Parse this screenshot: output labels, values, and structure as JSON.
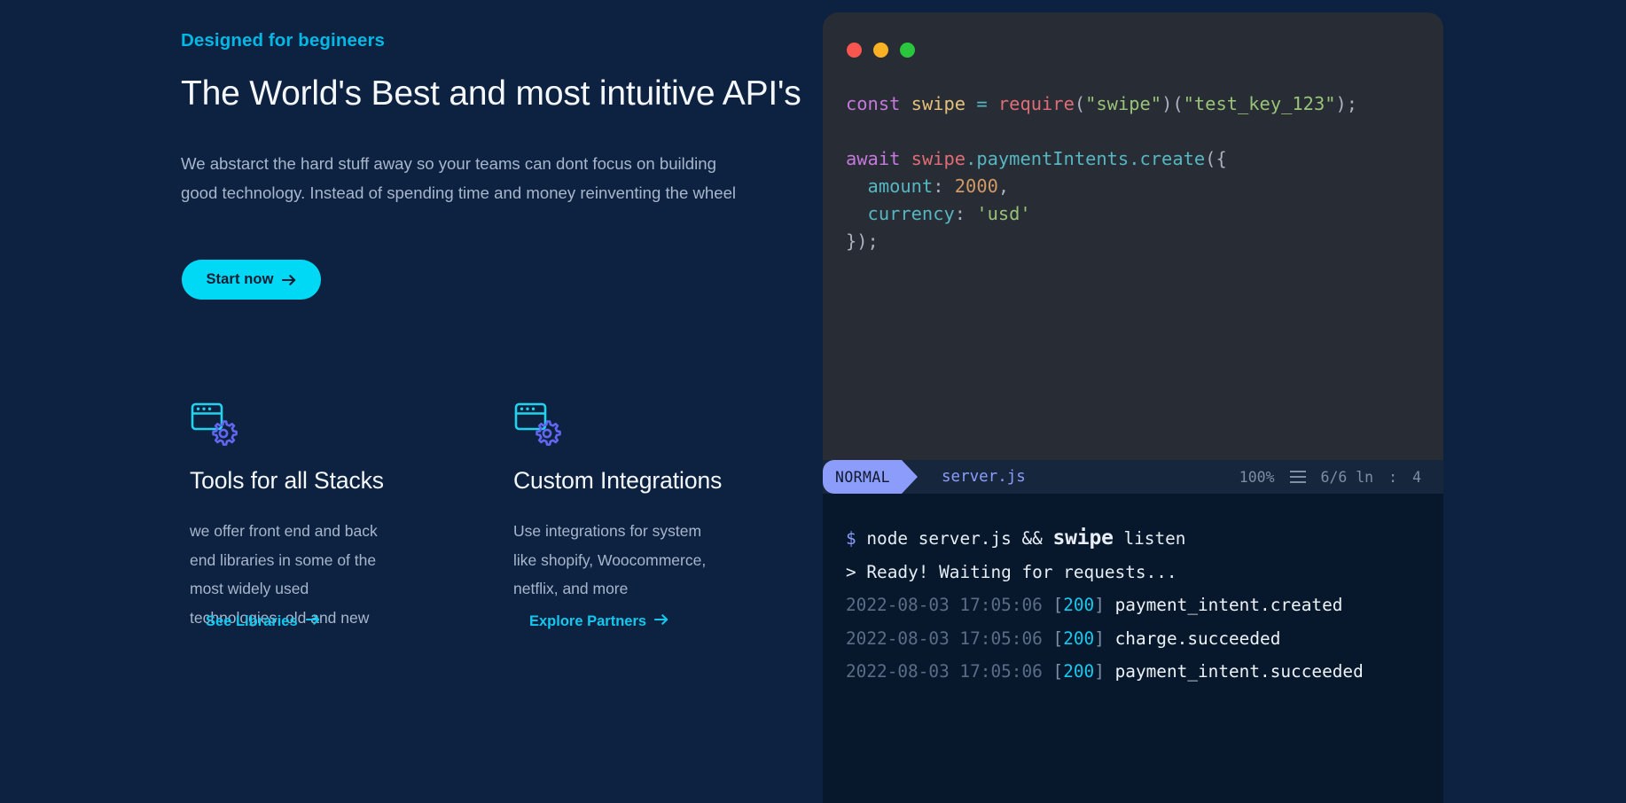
{
  "page": {
    "background_color": "#0d2240"
  },
  "hero": {
    "eyebrow": "Designed for begineers",
    "eyebrow_color": "#00b8e6",
    "title": "The World's Best and most intuitive API's",
    "body": "We abstarct the hard stuff away so your teams can dont focus on building good technology. Instead of spending time and money reinventing the wheel",
    "cta": {
      "label": "Start now",
      "icon": "arrow-right-icon",
      "background_color": "#00d9f5",
      "text_color": "#0a1d33"
    }
  },
  "features": [
    {
      "icon": "browser-window-gear-icon",
      "icon_window_color": "#22d3ee",
      "icon_gear_color": "#6366f1",
      "title": "Tools for all Stacks",
      "body": "we offer front end and back end libraries in some of the most widely used technologies. old and new",
      "link_label": "See Libraries",
      "link_icon": "arrow-right-icon",
      "link_color": "#13c8ef"
    },
    {
      "icon": "browser-window-gear-icon",
      "icon_window_color": "#22d3ee",
      "icon_gear_color": "#6366f1",
      "title": "Custom Integrations",
      "body": "Use integrations for system like shopify, Woocommerce, netflix, and more",
      "link_label": "Explore Partners",
      "link_icon": "arrow-right-icon",
      "link_color": "#13c8ef"
    }
  ],
  "editor": {
    "background_color": "#282c34",
    "window_controls": [
      {
        "name": "close-dot",
        "color": "#f8564f"
      },
      {
        "name": "minimize-dot",
        "color": "#fbb124"
      },
      {
        "name": "maximize-dot",
        "color": "#29c63e"
      }
    ],
    "code_lines": [
      "const swipe = require(\"swipe\")(\"test_key_123\");",
      "",
      "await swipe.paymentIntents.create({",
      "  amount: 2000,",
      "  currency: 'usd'",
      "});"
    ],
    "tokens": {
      "keyword_color": "#c678dd",
      "variable_color": "#e5c07b",
      "function_color": "#e06c75",
      "string_color": "#98c379",
      "property_color": "#56b6c2",
      "number_color": "#d19a66",
      "punctuation_color": "#abb2bf"
    },
    "code_parts": {
      "l1_const": "const",
      "l1_swipe": "swipe",
      "l1_eq": "=",
      "l1_require": "require",
      "l1_open": "(",
      "l1_str1": "\"swipe\"",
      "l1_mid": ")(",
      "l1_str2": "\"test_key_123\"",
      "l1_close": ");",
      "l3_await": "await",
      "l3_swipe": "swipe",
      "l3_dot1": ".",
      "l3_prop": "paymentIntents",
      "l3_dot2": ".",
      "l3_create": "create",
      "l3_open": "({",
      "l4_key": "  amount",
      "l4_colon": ":",
      "l4_num": "2000",
      "l4_comma": ",",
      "l5_key": "  currency",
      "l5_colon": ":",
      "l5_str": "'usd'",
      "l6_close": "});"
    }
  },
  "status_bar": {
    "background_color": "#16263d",
    "mode": "NORMAL",
    "mode_pill_color": "#8b9cfb",
    "filename": "server.js",
    "filename_color": "#8b9cfb",
    "zoom": "100%",
    "menu_icon": "hamburger-icon",
    "line_info": "6/6 ln",
    "separator": ":",
    "column": "4"
  },
  "terminal": {
    "background_color": "#07182c",
    "command": {
      "prompt": "$",
      "text_before": "node server.js && ",
      "brand": "swipe",
      "text_after": " listen"
    },
    "ready_line": {
      "prompt": ">",
      "text": "Ready! Waiting for requests..."
    },
    "logs": [
      {
        "timestamp": "2022-08-03 17:05:06",
        "open_bracket": "[",
        "status": "200",
        "close_bracket": "]",
        "message": "payment_intent.created"
      },
      {
        "timestamp": "2022-08-03 17:05:06",
        "open_bracket": "[",
        "status": "200",
        "close_bracket": "]",
        "message": "charge.succeeded"
      },
      {
        "timestamp": "2022-08-03 17:05:06",
        "open_bracket": "[",
        "status": "200",
        "close_bracket": "]",
        "message": "payment_intent.succeeded"
      }
    ],
    "status_color": "#17c9ee",
    "timestamp_color": "#5b6d86"
  }
}
